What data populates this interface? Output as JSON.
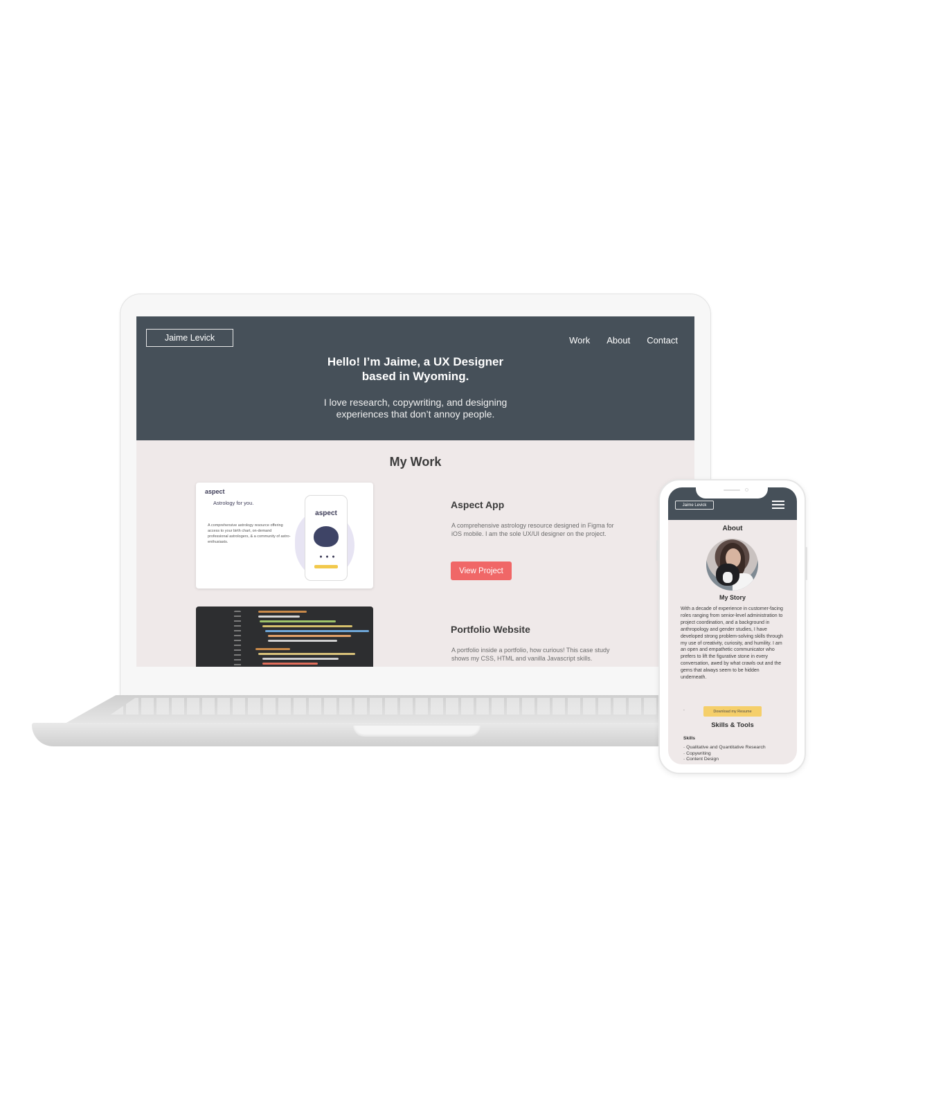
{
  "laptop_site": {
    "logo": "Jaime Levick",
    "nav": [
      "Work",
      "About",
      "Contact"
    ],
    "hero_title_line1": "Hello! I’m Jaime, a UX Designer",
    "hero_title_line2": "based in Wyoming.",
    "hero_sub_line1": "I love research, copywriting, and designing",
    "hero_sub_line2": "experiences that don’t annoy people.",
    "section_title": "My Work",
    "projects": [
      {
        "title": "Aspect App",
        "description": "A comprehensive astrology resource designed in Figma for iOS mobile. I am the sole UX/UI designer on the project.",
        "button": "View Project",
        "thumbnail": {
          "brand": "aspect",
          "tagline": "Astrology for you.",
          "description": "A comprehensive astrology resource offering access to your birth chart, on-demand professional astrologers, & a community of astro-enthusiasts.",
          "phone_brand": "aspect"
        }
      },
      {
        "title": "Portfolio Website",
        "description": "A portfolio inside a portfolio, how curious! This case study shows my CSS, HTML and vanilla Javascript skills."
      }
    ]
  },
  "mobile_site": {
    "logo": "Jaime Levick",
    "menu_icon": "hamburger-menu-icon",
    "page_title": "About",
    "story_title": "My Story",
    "story": "With a decade of experience in customer-facing roles ranging from senior-level administration to project coordination, and a background in anthropology and gender studies, I have developed strong problem-solving skills through my use of creativity, curiosity, and humility. I am an open and empathetic communicator who prefers to lift the figurative stone in every conversation, awed by what crawls out and the gems that always seem to be hidden underneath.",
    "resume_button": "Download my Resume",
    "skills_title": "Skills & Tools",
    "skills_label": "Skills",
    "skills": [
      "Qualitative and Quantitative Research",
      "Copywriting",
      "Content Design"
    ]
  },
  "colors": {
    "header": "#465059",
    "background": "#efe9e9",
    "accent_button": "#f06767",
    "resume_button": "#f5cf6a"
  }
}
